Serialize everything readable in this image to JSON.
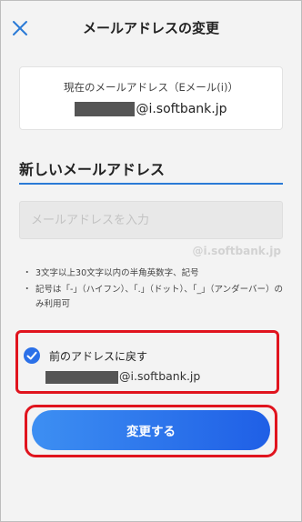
{
  "header": {
    "title": "メールアドレスの変更",
    "close_icon": "close-icon"
  },
  "current_card": {
    "label": "現在のメールアドレス（Eメール(i)）",
    "domain": "@i.softbank.jp"
  },
  "new_address": {
    "heading": "新しいメールアドレス",
    "input_value": "",
    "input_placeholder": "メールアドレスを入力",
    "domain_hint": "@i.softbank.jp"
  },
  "notes": [
    "3文字以上30文字以内の半角英数字、記号",
    "記号は「-」（ハイフン）、「.」（ドット）、「_」（アンダーバー）のみ利用可"
  ],
  "revert": {
    "label": "前のアドレスに戻す",
    "domain": "@i.softbank.jp",
    "checked": true
  },
  "submit": {
    "label": "変更する"
  },
  "colors": {
    "accent": "#2a7ad6",
    "highlight_outline": "#e0141e",
    "button_gradient_start": "#3d8ff2",
    "button_gradient_end": "#1f5fe6"
  }
}
